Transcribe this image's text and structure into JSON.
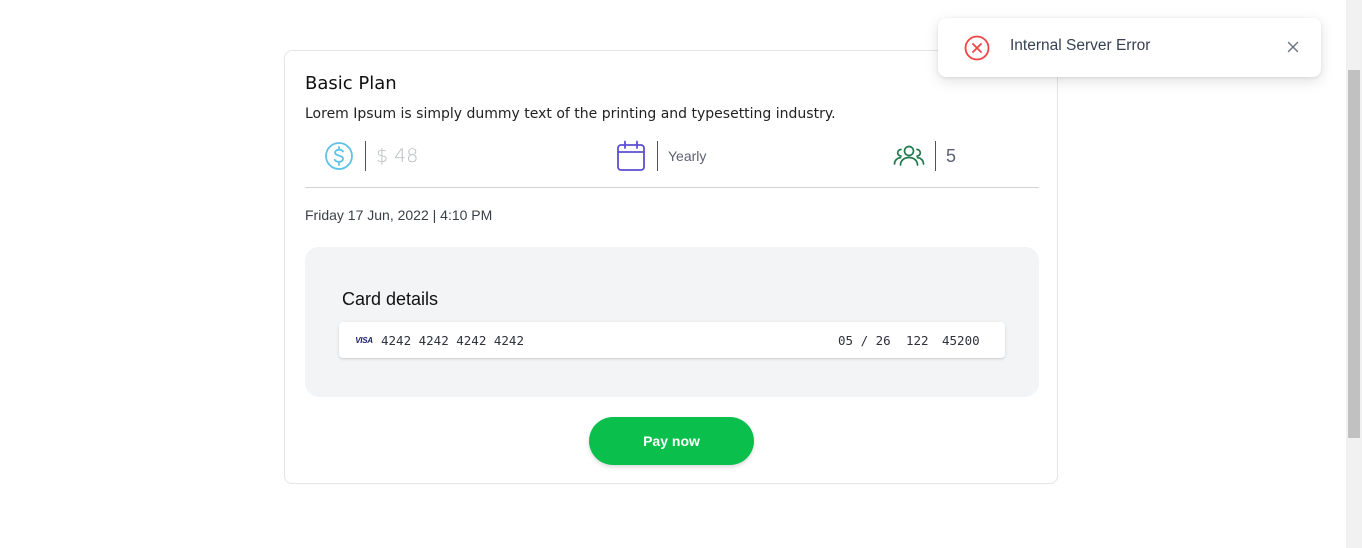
{
  "plan": {
    "title": "Basic Plan",
    "description": "Lorem Ipsum is simply dummy text of the printing and typesetting industry.",
    "price": "$ 48",
    "period": "Yearly",
    "users": "5"
  },
  "datetime": "Friday 17 Jun, 2022 | 4:10 PM",
  "payment": {
    "title": "Card details",
    "card_brand": "VISA",
    "card_number": "4242 4242 4242 4242",
    "expiry": "05 / 26",
    "cvc": "122",
    "zip": "45200"
  },
  "pay_button": "Pay now",
  "toast": {
    "message": "Internal Server Error"
  },
  "icons": {
    "price": "dollar-circle-icon",
    "period": "calendar-icon",
    "users": "users-icon",
    "toast_status": "error-circle-icon",
    "toast_close": "close-icon"
  },
  "colors": {
    "pay_button": "#0bbf4d",
    "dollar_icon": "#5ec3e8",
    "calendar_icon": "#5b4fd1",
    "users_icon": "#1f7a4c",
    "error_icon": "#ef4444"
  }
}
